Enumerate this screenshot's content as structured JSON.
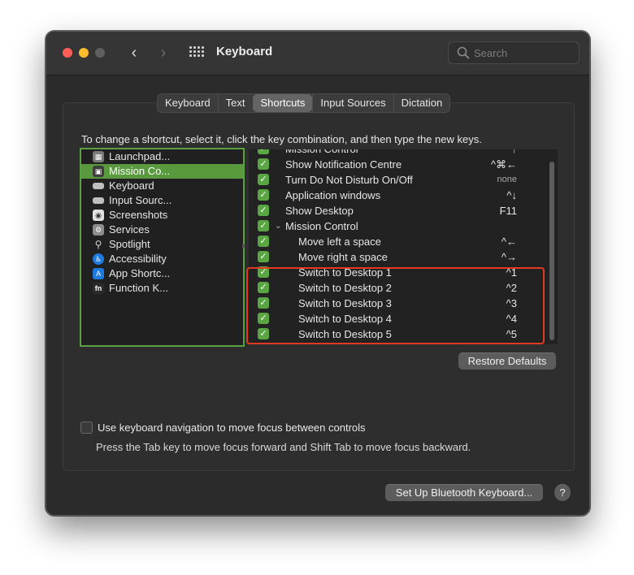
{
  "window": {
    "title": "Keyboard"
  },
  "search": {
    "placeholder": "Search"
  },
  "tabs": [
    {
      "label": "Keyboard"
    },
    {
      "label": "Text"
    },
    {
      "label": "Shortcuts",
      "active": true
    },
    {
      "label": "Input Sources"
    },
    {
      "label": "Dictation"
    }
  ],
  "instruction": "To change a shortcut, select it, click the key combination, and then type the new keys.",
  "categories": [
    {
      "label": "Launchpad...",
      "icon": "launchpad-icon"
    },
    {
      "label": "Mission Co...",
      "icon": "mission-control-icon",
      "selected": true
    },
    {
      "label": "Keyboard",
      "icon": "keyboard-icon"
    },
    {
      "label": "Input Sourc...",
      "icon": "input-sources-icon"
    },
    {
      "label": "Screenshots",
      "icon": "screenshot-icon"
    },
    {
      "label": "Services",
      "icon": "gear-icon"
    },
    {
      "label": "Spotlight",
      "icon": "magnifier-icon"
    },
    {
      "label": "Accessibility",
      "icon": "accessibility-icon"
    },
    {
      "label": "App Shortc...",
      "icon": "app-store-icon"
    },
    {
      "label": "Function K...",
      "icon": "fn-icon"
    }
  ],
  "shortcuts": [
    {
      "label": "Mission Control",
      "key": "^↑",
      "checked": true
    },
    {
      "label": "Show Notification Centre",
      "key": "^⌘←",
      "checked": true
    },
    {
      "label": "Turn Do Not Disturb On/Off",
      "key": "none",
      "checked": true
    },
    {
      "label": "Application windows",
      "key": "^↓",
      "checked": true
    },
    {
      "label": "Show Desktop",
      "key": "F11",
      "checked": true
    },
    {
      "label": "Mission Control",
      "key": "",
      "checked": true,
      "group": true
    },
    {
      "label": "Move left a space",
      "key": "^←",
      "checked": true
    },
    {
      "label": "Move right a space",
      "key": "^→",
      "checked": true
    },
    {
      "label": "Switch to Desktop 1",
      "key": "^1",
      "checked": true
    },
    {
      "label": "Switch to Desktop 2",
      "key": "^2",
      "checked": true
    },
    {
      "label": "Switch to Desktop 3",
      "key": "^3",
      "checked": true
    },
    {
      "label": "Switch to Desktop 4",
      "key": "^4",
      "checked": true
    },
    {
      "label": "Switch to Desktop 5",
      "key": "^5",
      "checked": true
    }
  ],
  "buttons": {
    "restore": "Restore Defaults",
    "bluetooth": "Set Up Bluetooth Keyboard...",
    "help": "?"
  },
  "keyboard_nav": {
    "label": "Use keyboard navigation to move focus between controls",
    "hint": "Press the Tab key to move focus forward and Shift Tab to move focus backward.",
    "checked": false
  },
  "colors": {
    "selection_green": "#5a9a3f",
    "checkbox_green": "#5aa642",
    "highlight_red": "#e23a22"
  }
}
